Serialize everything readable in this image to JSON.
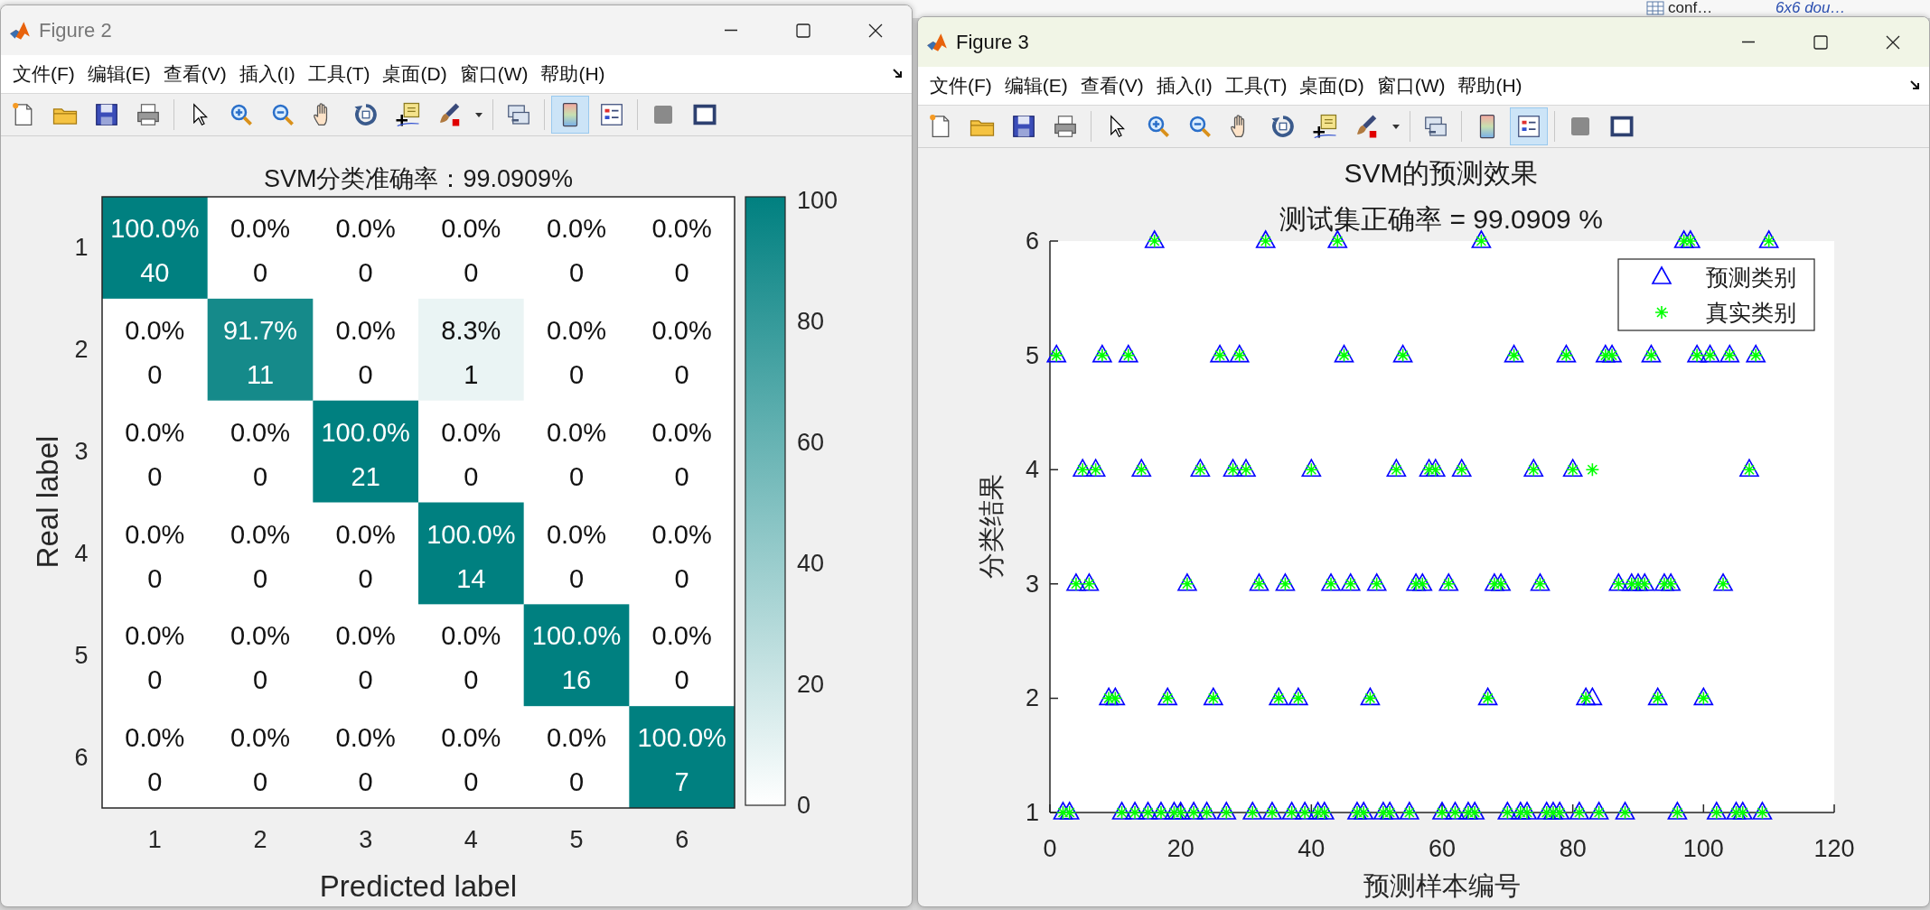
{
  "desktop": {
    "workspace_name": "conf…",
    "workspace_value": "6x6 dou…"
  },
  "figure2": {
    "title": "Figure 2",
    "active": false,
    "menu": [
      "文件(F)",
      "编辑(E)",
      "查看(V)",
      "插入(I)",
      "工具(T)",
      "桌面(D)",
      "窗口(W)",
      "帮助(H)"
    ],
    "toolbar": {
      "colorbar_pressed": true,
      "legend_pressed": false
    },
    "matrix": {
      "title": "SVM分类准确率：99.0909%",
      "xlabel": "Predicted label",
      "ylabel": "Real label",
      "xticks": [
        "1",
        "2",
        "3",
        "4",
        "5",
        "6"
      ],
      "yticks": [
        "1",
        "2",
        "3",
        "4",
        "5",
        "6"
      ],
      "rows": [
        {
          "cells": [
            {
              "percent": "100.0%",
              "count": "40",
              "color": "#008080"
            },
            {
              "percent": "0.0%",
              "count": "0"
            },
            {
              "percent": "0.0%",
              "count": "0"
            },
            {
              "percent": "0.0%",
              "count": "0"
            },
            {
              "percent": "0.0%",
              "count": "0"
            },
            {
              "percent": "0.0%",
              "count": "0"
            }
          ]
        },
        {
          "cells": [
            {
              "percent": "0.0%",
              "count": "0"
            },
            {
              "percent": "91.7%",
              "count": "11",
              "color": "#158a8a"
            },
            {
              "percent": "0.0%",
              "count": "0"
            },
            {
              "percent": "8.3%",
              "count": "1",
              "color": "#eaf4f4"
            },
            {
              "percent": "0.0%",
              "count": "0"
            },
            {
              "percent": "0.0%",
              "count": "0"
            }
          ]
        },
        {
          "cells": [
            {
              "percent": "0.0%",
              "count": "0"
            },
            {
              "percent": "0.0%",
              "count": "0"
            },
            {
              "percent": "100.0%",
              "count": "21",
              "color": "#008080"
            },
            {
              "percent": "0.0%",
              "count": "0"
            },
            {
              "percent": "0.0%",
              "count": "0"
            },
            {
              "percent": "0.0%",
              "count": "0"
            }
          ]
        },
        {
          "cells": [
            {
              "percent": "0.0%",
              "count": "0"
            },
            {
              "percent": "0.0%",
              "count": "0"
            },
            {
              "percent": "0.0%",
              "count": "0"
            },
            {
              "percent": "100.0%",
              "count": "14",
              "color": "#008080"
            },
            {
              "percent": "0.0%",
              "count": "0"
            },
            {
              "percent": "0.0%",
              "count": "0"
            }
          ]
        },
        {
          "cells": [
            {
              "percent": "0.0%",
              "count": "0"
            },
            {
              "percent": "0.0%",
              "count": "0"
            },
            {
              "percent": "0.0%",
              "count": "0"
            },
            {
              "percent": "0.0%",
              "count": "0"
            },
            {
              "percent": "100.0%",
              "count": "16",
              "color": "#008080"
            },
            {
              "percent": "0.0%",
              "count": "0"
            }
          ]
        },
        {
          "cells": [
            {
              "percent": "0.0%",
              "count": "0"
            },
            {
              "percent": "0.0%",
              "count": "0"
            },
            {
              "percent": "0.0%",
              "count": "0"
            },
            {
              "percent": "0.0%",
              "count": "0"
            },
            {
              "percent": "0.0%",
              "count": "0"
            },
            {
              "percent": "100.0%",
              "count": "7",
              "color": "#008080"
            }
          ]
        }
      ],
      "colorbar": {
        "ticks": [
          "100",
          "80",
          "60",
          "40",
          "20",
          "0"
        ]
      }
    }
  },
  "figure3": {
    "title": "Figure 3",
    "active": true,
    "menu": [
      "文件(F)",
      "编辑(E)",
      "查看(V)",
      "插入(I)",
      "工具(T)",
      "桌面(D)",
      "窗口(W)",
      "帮助(H)"
    ],
    "toolbar": {
      "colorbar_pressed": false,
      "legend_pressed": true
    },
    "plot": {
      "accuracy": "测试集正确率 = 99.0909 %",
      "chart_data": {
        "type": "scatter",
        "title": "SVM的预测效果",
        "xlabel": "预测样本编号",
        "ylabel": "分类结果",
        "x": [
          1,
          2,
          3,
          4,
          5,
          6,
          7,
          8,
          9,
          10,
          11,
          12,
          13,
          14,
          15,
          16,
          17,
          18,
          19,
          20,
          21,
          22,
          23,
          24,
          25,
          26,
          27,
          28,
          29,
          30,
          31,
          32,
          33,
          34,
          35,
          36,
          37,
          38,
          39,
          40,
          41,
          42,
          43,
          44,
          45,
          46,
          47,
          48,
          49,
          50,
          51,
          52,
          53,
          54,
          55,
          56,
          57,
          58,
          59,
          60,
          61,
          62,
          63,
          64,
          65,
          66,
          67,
          68,
          69,
          70,
          71,
          72,
          73,
          74,
          75,
          76,
          77,
          78,
          79,
          80,
          81,
          82,
          83,
          84,
          85,
          86,
          87,
          88,
          89,
          90,
          91,
          92,
          93,
          94,
          95,
          96,
          97,
          98,
          99,
          100,
          101,
          102,
          103,
          104,
          105,
          106,
          107,
          108,
          109,
          110
        ],
        "series": [
          {
            "name": "预测类别",
            "color": "#0000ff",
            "marker": "triangle",
            "values": [
              5,
              1,
              1,
              3,
              4,
              3,
              4,
              5,
              2,
              2,
              1,
              5,
              1,
              4,
              1,
              6,
              1,
              2,
              1,
              1,
              3,
              1,
              4,
              1,
              2,
              5,
              1,
              4,
              5,
              4,
              1,
              3,
              6,
              1,
              2,
              3,
              1,
              2,
              1,
              4,
              1,
              1,
              3,
              6,
              5,
              3,
              1,
              1,
              2,
              3,
              1,
              1,
              4,
              5,
              1,
              3,
              3,
              4,
              4,
              1,
              3,
              1,
              4,
              1,
              1,
              6,
              2,
              3,
              3,
              1,
              5,
              1,
              1,
              4,
              3,
              1,
              1,
              1,
              5,
              4,
              1,
              2,
              2,
              1,
              5,
              5,
              3,
              1,
              3,
              3,
              3,
              5,
              2,
              3,
              3,
              1,
              6,
              6,
              5,
              2,
              5,
              1,
              3,
              5,
              1,
              1,
              4,
              5,
              1,
              6
            ]
          },
          {
            "name": "真实类别",
            "color": "#00ff00",
            "marker": "cross",
            "values": [
              5,
              1,
              1,
              3,
              4,
              3,
              4,
              5,
              2,
              2,
              1,
              5,
              1,
              4,
              1,
              6,
              1,
              2,
              1,
              1,
              3,
              1,
              4,
              1,
              2,
              5,
              1,
              4,
              5,
              4,
              1,
              3,
              6,
              1,
              2,
              3,
              1,
              2,
              1,
              4,
              1,
              1,
              3,
              6,
              5,
              3,
              1,
              1,
              2,
              3,
              1,
              1,
              4,
              5,
              1,
              3,
              3,
              4,
              4,
              1,
              3,
              1,
              4,
              1,
              1,
              6,
              2,
              3,
              3,
              1,
              5,
              1,
              1,
              4,
              3,
              1,
              1,
              1,
              5,
              4,
              1,
              2,
              4,
              1,
              5,
              5,
              3,
              1,
              3,
              3,
              3,
              5,
              2,
              3,
              3,
              1,
              6,
              6,
              5,
              2,
              5,
              1,
              3,
              5,
              1,
              1,
              4,
              5,
              1,
              6
            ]
          }
        ],
        "legend": true,
        "xlim": [
          0,
          120
        ],
        "ylim": [
          1,
          6
        ],
        "xticks": [
          {
            "value": 0,
            "label": "0"
          },
          {
            "value": 20,
            "label": "20"
          },
          {
            "value": 40,
            "label": "40"
          },
          {
            "value": 60,
            "label": "60"
          },
          {
            "value": 80,
            "label": "80"
          },
          {
            "value": 100,
            "label": "100"
          },
          {
            "value": 120,
            "label": "120"
          }
        ],
        "yticks": [
          {
            "value": 1,
            "label": "1"
          },
          {
            "value": 2,
            "label": "2"
          },
          {
            "value": 3,
            "label": "3"
          },
          {
            "value": 4,
            "label": "4"
          },
          {
            "value": 5,
            "label": "5"
          },
          {
            "value": 6,
            "label": "6"
          }
        ]
      }
    }
  }
}
